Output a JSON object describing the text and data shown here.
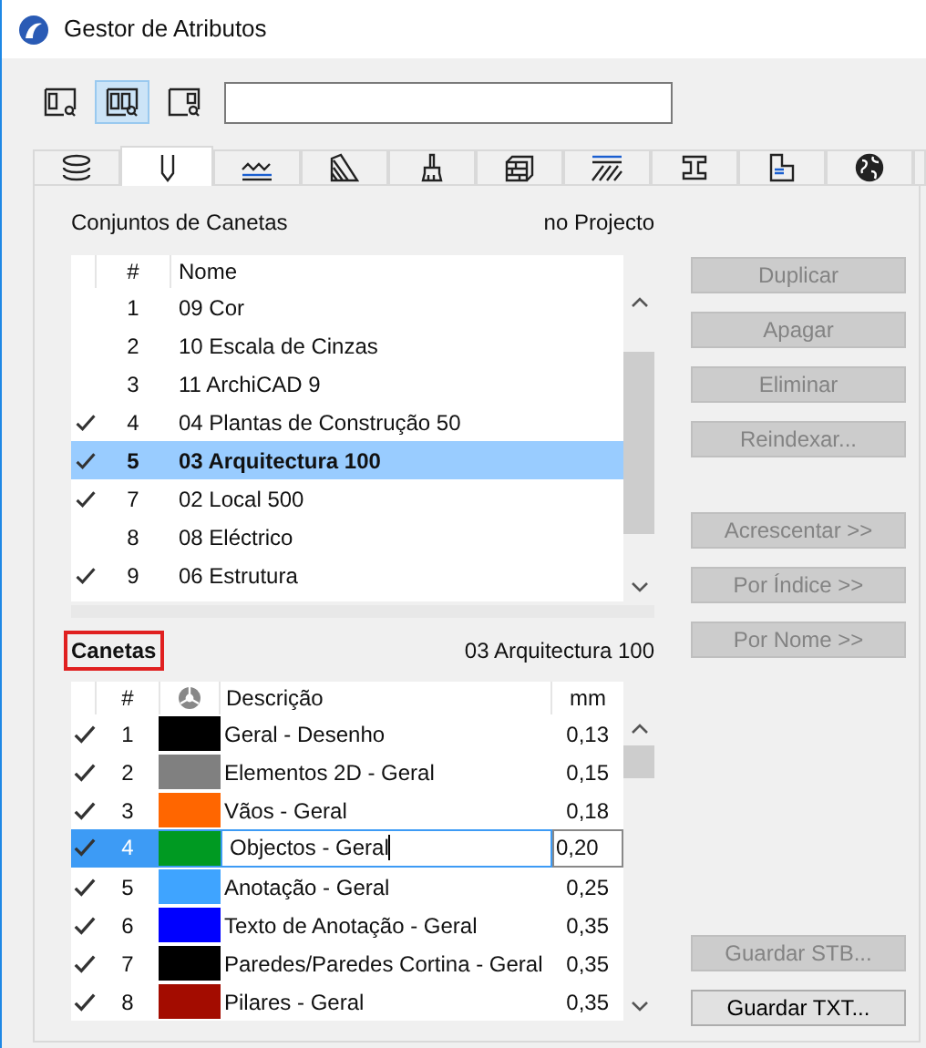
{
  "window": {
    "title": "Gestor de Atributos"
  },
  "view_buttons": [
    {
      "kind": "left",
      "selected": false
    },
    {
      "kind": "both",
      "selected": true
    },
    {
      "kind": "right",
      "selected": false
    }
  ],
  "tabs": [
    {
      "kind": "layers",
      "selected": false
    },
    {
      "kind": "pen",
      "selected": true
    },
    {
      "kind": "lines",
      "selected": false
    },
    {
      "kind": "fills",
      "selected": false
    },
    {
      "kind": "brush",
      "selected": false
    },
    {
      "kind": "bricks",
      "selected": false
    },
    {
      "kind": "hatch",
      "selected": false
    },
    {
      "kind": "beam",
      "selected": false
    },
    {
      "kind": "plan",
      "selected": false
    },
    {
      "kind": "globe",
      "selected": false
    }
  ],
  "pen_sets": {
    "title": "Conjuntos de Canetas",
    "location": "no Projecto",
    "columns": [
      "#",
      "Nome"
    ],
    "rows": [
      {
        "number": "1",
        "name": "09 Cor",
        "checked": false,
        "selected": false
      },
      {
        "number": "2",
        "name": "10 Escala de Cinzas",
        "checked": false,
        "selected": false
      },
      {
        "number": "3",
        "name": "11 ArchiCAD 9",
        "checked": false,
        "selected": false
      },
      {
        "number": "4",
        "name": "04 Plantas de Construção 50",
        "checked": true,
        "selected": false
      },
      {
        "number": "5",
        "name": "03 Arquitectura 100",
        "checked": true,
        "selected": true
      },
      {
        "number": "7",
        "name": "02 Local 500",
        "checked": true,
        "selected": false
      },
      {
        "number": "8",
        "name": "08 Eléctrico",
        "checked": false,
        "selected": false
      },
      {
        "number": "9",
        "name": "06 Estrutura",
        "checked": true,
        "selected": false
      }
    ]
  },
  "pens": {
    "title": "Canetas",
    "set_name": "03 Arquitectura 100",
    "columns": [
      "#",
      "Descrição",
      "mm"
    ],
    "rows": [
      {
        "number": "1",
        "color": "#000000",
        "description": "Geral - Desenho",
        "mm": "0,13",
        "checked": true,
        "selected": false
      },
      {
        "number": "2",
        "color": "#808080",
        "description": "Elementos 2D - Geral",
        "mm": "0,15",
        "checked": true,
        "selected": false
      },
      {
        "number": "3",
        "color": "#ff6600",
        "description": "Vãos - Geral",
        "mm": "0,18",
        "checked": true,
        "selected": false
      },
      {
        "number": "4",
        "color": "#009a22",
        "description": "Objectos - Geral",
        "mm": "0,20",
        "checked": true,
        "selected": true
      },
      {
        "number": "5",
        "color": "#3fa4ff",
        "description": "Anotação - Geral",
        "mm": "0,25",
        "checked": true,
        "selected": false
      },
      {
        "number": "6",
        "color": "#0000ff",
        "description": "Texto de Anotação - Geral",
        "mm": "0,35",
        "checked": true,
        "selected": false
      },
      {
        "number": "7",
        "color": "#000000",
        "description": "Paredes/Paredes Cortina - Geral",
        "mm": "0,35",
        "checked": true,
        "selected": false
      },
      {
        "number": "8",
        "color": "#a30c00",
        "description": "Pilares - Geral",
        "mm": "0,35",
        "checked": true,
        "selected": false
      }
    ]
  },
  "button_groups": [
    [
      {
        "label": "Duplicar",
        "disabled": true
      },
      {
        "label": "Apagar",
        "disabled": true
      },
      {
        "label": "Eliminar",
        "disabled": true
      },
      {
        "label": "Reindexar...",
        "disabled": true
      }
    ],
    [
      {
        "label": "Acrescentar >>",
        "disabled": true
      },
      {
        "label": "Por Índice >>",
        "disabled": true
      },
      {
        "label": "Por Nome >>",
        "disabled": true
      }
    ],
    [
      {
        "label": "Guardar STB...",
        "disabled": true
      },
      {
        "label": "Guardar TXT...",
        "disabled": false
      }
    ]
  ]
}
